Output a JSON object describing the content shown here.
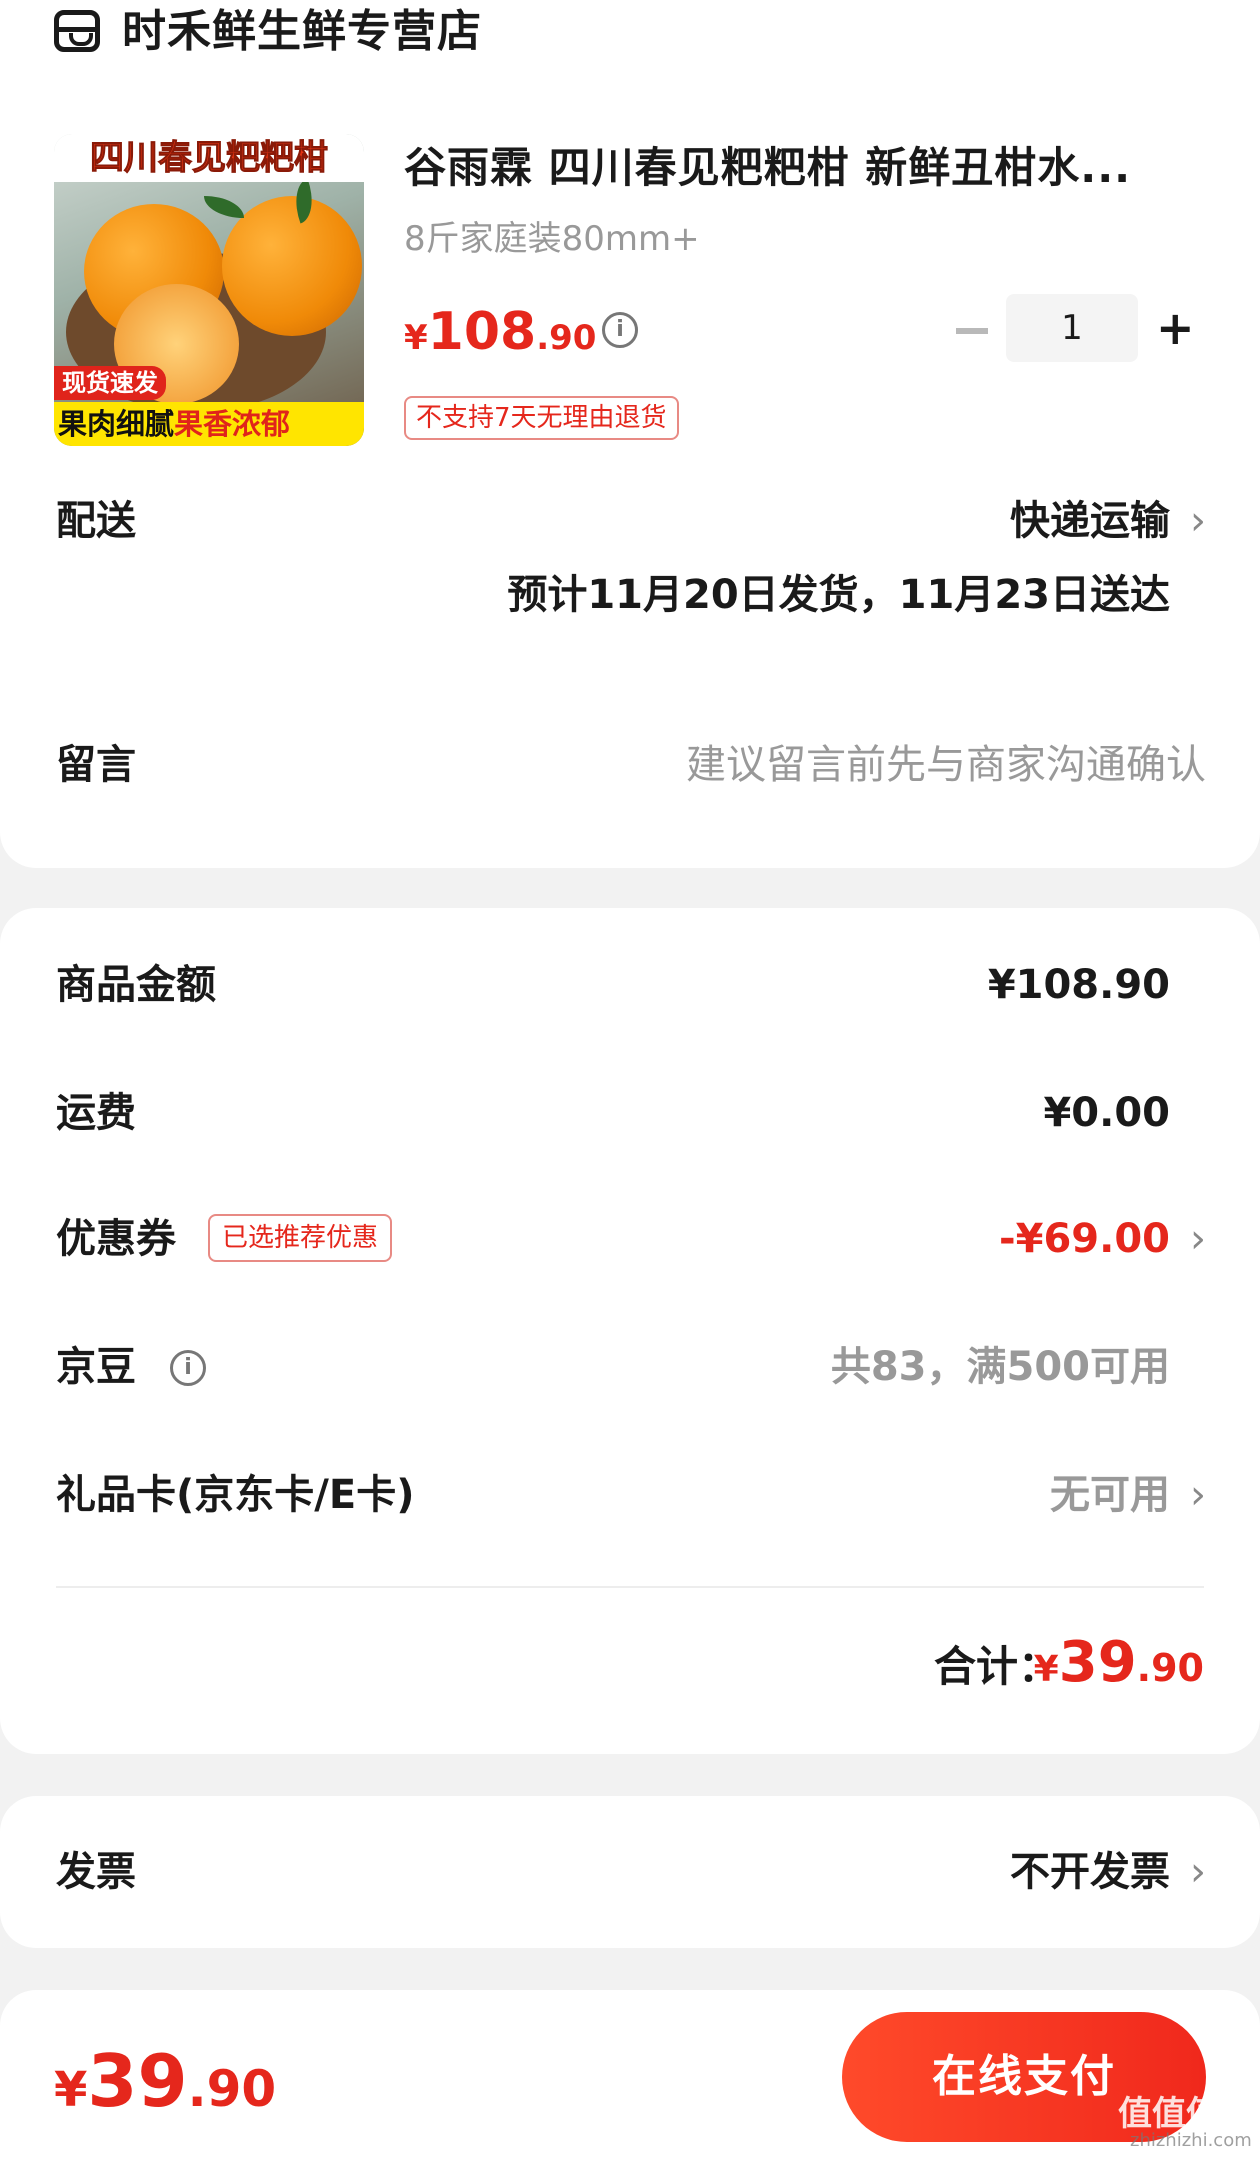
{
  "store": {
    "icon": "store-icon",
    "name": "时禾鲜生鲜专营店"
  },
  "product": {
    "image": {
      "banner_top": "四川春见粑粑柑",
      "tag_fast": "现货速发",
      "banner_bottom_1": "果肉细腻",
      "banner_bottom_2": "果香浓郁"
    },
    "title": "谷雨霖 四川春见粑粑柑 新鲜丑柑水...",
    "spec": "8斤家庭装80mm+",
    "price": {
      "symbol": "¥",
      "integer": "108",
      "decimal": ".90"
    },
    "return_tag": "不支持7天无理由退货",
    "quantity": "1",
    "minus_icon": "minus-icon",
    "plus_icon": "plus-icon"
  },
  "delivery": {
    "label": "配送",
    "method": "快递运输",
    "estimate": "预计11月20日发货，11月23日送达"
  },
  "message": {
    "label": "留言",
    "placeholder": "建议留言前先与商家沟通确认"
  },
  "amounts": {
    "goods_label": "商品金额",
    "goods_value": "¥108.90",
    "shipping_label": "运费",
    "shipping_value": "¥0.00",
    "coupon_label": "优惠券",
    "coupon_tag": "已选推荐优惠",
    "coupon_value": "-¥69.00",
    "jd_bean_label": "京豆",
    "jd_bean_value": "共83，满500可用",
    "giftcard_label": "礼品卡(京东卡/E卡)",
    "giftcard_value": "无可用",
    "total_label": "合计：",
    "total": {
      "symbol": "¥",
      "integer": "39",
      "decimal": ".90"
    }
  },
  "invoice": {
    "label": "发票",
    "value": "不开发票"
  },
  "bottom": {
    "amount": {
      "symbol": "¥",
      "integer": "39",
      "decimal": ".90"
    },
    "pay_button": "在线支付"
  },
  "watermark": {
    "main": "值值值",
    "sub": "zhizhizhi.com"
  },
  "colors": {
    "accent_red": "#e5271c",
    "muted": "#999999",
    "background": "#f2f2f2"
  }
}
